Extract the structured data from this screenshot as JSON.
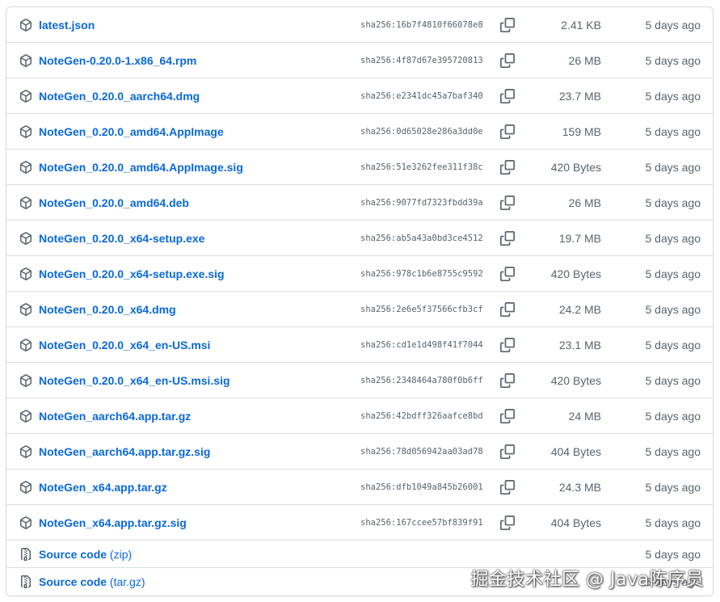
{
  "assets": [
    {
      "name": "latest.json",
      "sha": "sha256:16b7f4810f66078e8",
      "size": "2.41 KB",
      "date": "5 days ago"
    },
    {
      "name": "NoteGen-0.20.0-1.x86_64.rpm",
      "sha": "sha256:4f87d67e395720813",
      "size": "26 MB",
      "date": "5 days ago"
    },
    {
      "name": "NoteGen_0.20.0_aarch64.dmg",
      "sha": "sha256:e2341dc45a7baf340",
      "size": "23.7 MB",
      "date": "5 days ago"
    },
    {
      "name": "NoteGen_0.20.0_amd64.AppImage",
      "sha": "sha256:0d65028e286a3dd0e",
      "size": "159 MB",
      "date": "5 days ago"
    },
    {
      "name": "NoteGen_0.20.0_amd64.AppImage.sig",
      "sha": "sha256:51e3262fee311f38c",
      "size": "420 Bytes",
      "date": "5 days ago"
    },
    {
      "name": "NoteGen_0.20.0_amd64.deb",
      "sha": "sha256:9077fd7323fbdd39a",
      "size": "26 MB",
      "date": "5 days ago"
    },
    {
      "name": "NoteGen_0.20.0_x64-setup.exe",
      "sha": "sha256:ab5a43a0bd3ce4512",
      "size": "19.7 MB",
      "date": "5 days ago"
    },
    {
      "name": "NoteGen_0.20.0_x64-setup.exe.sig",
      "sha": "sha256:978c1b6e8755c9592",
      "size": "420 Bytes",
      "date": "5 days ago"
    },
    {
      "name": "NoteGen_0.20.0_x64.dmg",
      "sha": "sha256:2e6e5f37566cfb3cf",
      "size": "24.2 MB",
      "date": "5 days ago"
    },
    {
      "name": "NoteGen_0.20.0_x64_en-US.msi",
      "sha": "sha256:cd1e1d498f41f7044",
      "size": "23.1 MB",
      "date": "5 days ago"
    },
    {
      "name": "NoteGen_0.20.0_x64_en-US.msi.sig",
      "sha": "sha256:2348464a780f0b6ff",
      "size": "420 Bytes",
      "date": "5 days ago"
    },
    {
      "name": "NoteGen_aarch64.app.tar.gz",
      "sha": "sha256:42bdff326aafce8bd",
      "size": "24 MB",
      "date": "5 days ago"
    },
    {
      "name": "NoteGen_aarch64.app.tar.gz.sig",
      "sha": "sha256:78d056942aa03ad78",
      "size": "404 Bytes",
      "date": "5 days ago"
    },
    {
      "name": "NoteGen_x64.app.tar.gz",
      "sha": "sha256:dfb1049a845b26001",
      "size": "24.3 MB",
      "date": "5 days ago"
    },
    {
      "name": "NoteGen_x64.app.tar.gz.sig",
      "sha": "sha256:167ccee57bf839f91",
      "size": "404 Bytes",
      "date": "5 days ago"
    }
  ],
  "source": [
    {
      "name": "Source code",
      "suffix": "(zip)",
      "date": "5 days ago"
    },
    {
      "name": "Source code",
      "suffix": "(tar.gz)",
      "date": "5 days ago"
    }
  ],
  "icons": {
    "asset": "package-icon",
    "source": "file-zip-icon",
    "copy": "copy-icon"
  },
  "colors": {
    "link": "#0969da",
    "muted": "#59636e",
    "border": "#d1d9e0"
  },
  "watermark": "掘金技术社区 @ Java陈序员"
}
